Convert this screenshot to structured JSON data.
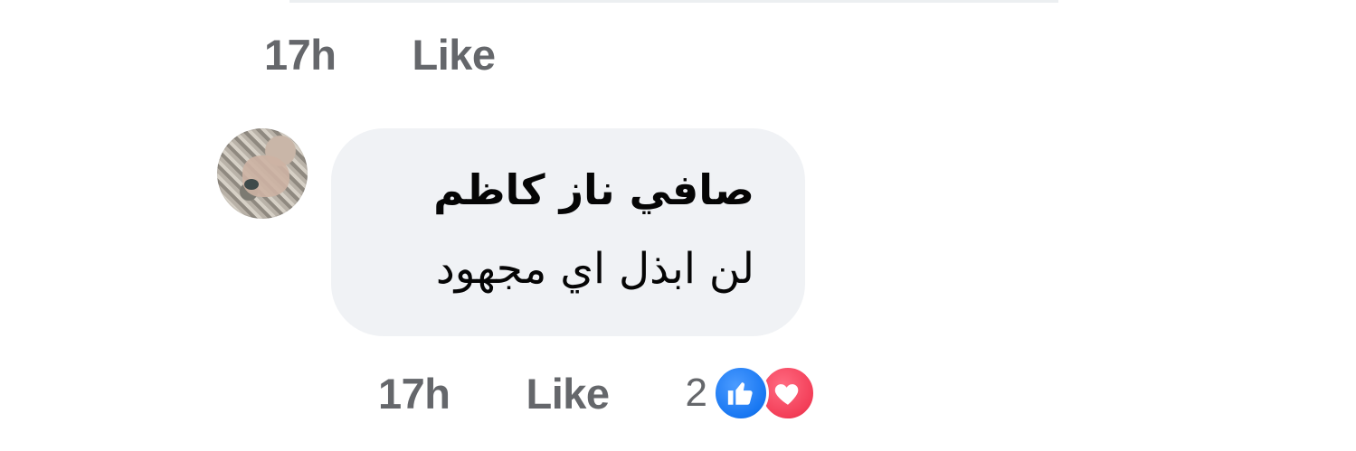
{
  "previous_comment": {
    "time": "17h",
    "like_label": "Like"
  },
  "comment": {
    "author": "صافي ناز كاظم",
    "text": "لن ابذل اي مجهود",
    "time": "17h",
    "like_label": "Like",
    "reaction_count": "2",
    "reactions": [
      "like-reaction-icon",
      "love-reaction-icon"
    ]
  },
  "colors": {
    "bubble_bg": "#f0f2f5",
    "meta_text": "#65676b",
    "like_blue": "#1877f2",
    "love_red": "#f33e58"
  }
}
